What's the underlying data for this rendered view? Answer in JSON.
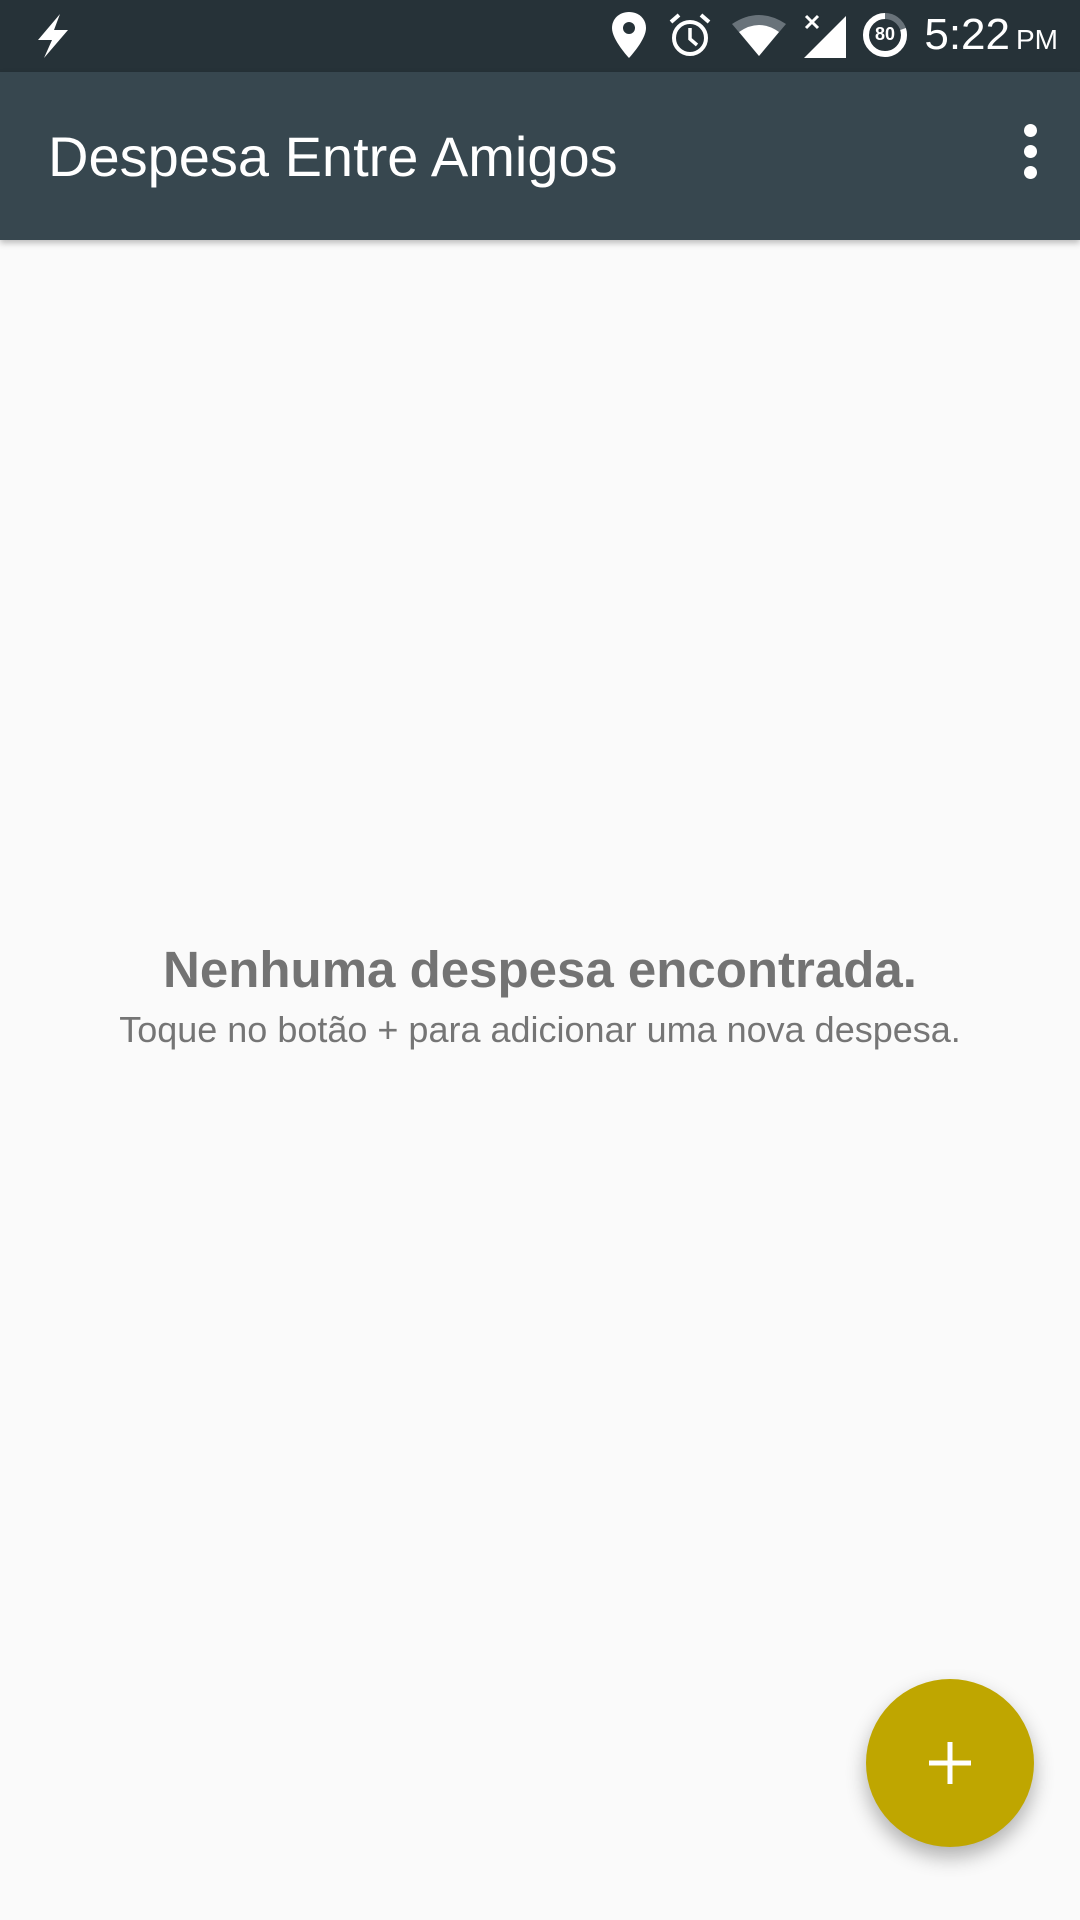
{
  "status_bar": {
    "time": "5:22",
    "ampm": "PM",
    "battery": "80",
    "icons": [
      "flash-icon",
      "location-icon",
      "alarm-icon",
      "wifi-icon",
      "signal-icon",
      "battery-icon"
    ]
  },
  "toolbar": {
    "title": "Despesa Entre Amigos",
    "menu_icon": "more-vert-icon"
  },
  "empty_state": {
    "title": "Nenhuma despesa encontrada.",
    "subtitle": "Toque no botão + para adicionar uma nova despesa."
  },
  "fab": {
    "icon": "plus-icon",
    "color": "#bfa600"
  }
}
